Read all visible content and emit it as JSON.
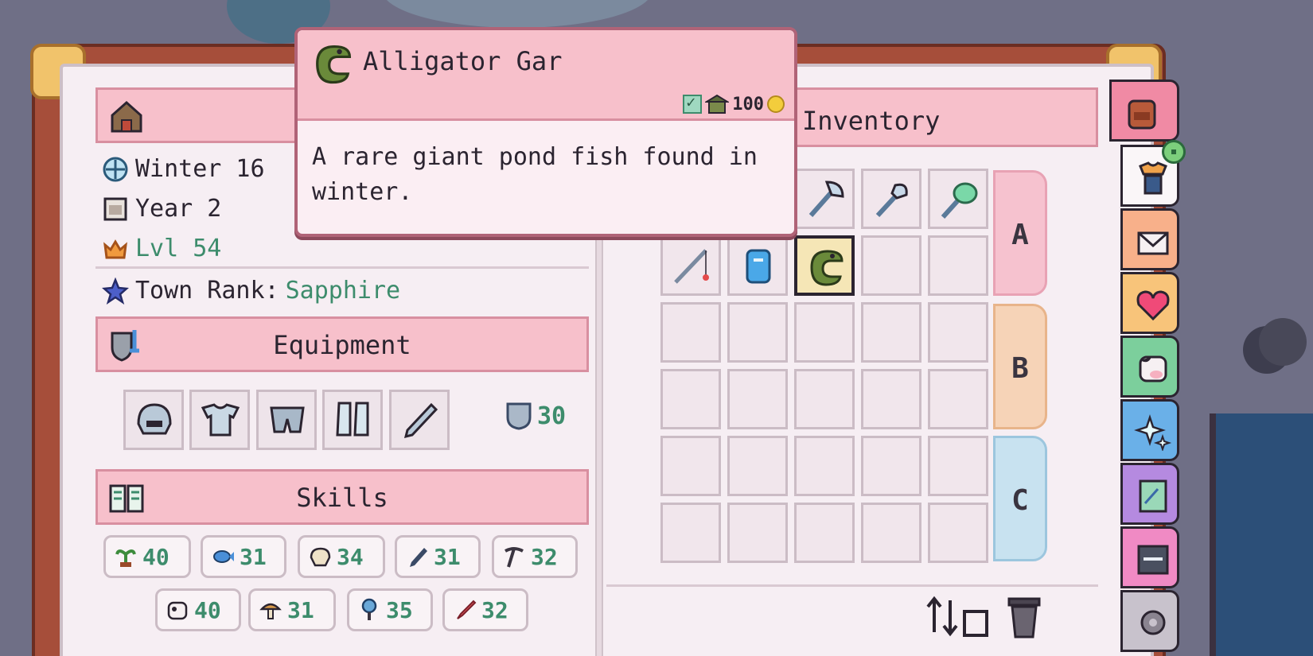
{
  "tooltip": {
    "item_name": "Alligator Gar",
    "description": "A rare giant pond fish found in winter.",
    "price": "100",
    "icon": "alligator-gar-icon"
  },
  "status": {
    "season": "Winter 16",
    "year": "Year 2",
    "level": "Lvl 54",
    "town_rank_label": "Town Rank:",
    "town_rank_value": "Sapphire"
  },
  "sections": {
    "equipment": "Equipment",
    "skills": "Skills",
    "inventory": "Inventory"
  },
  "equipment": {
    "slots": [
      "helmet-icon",
      "chestplate-icon",
      "leggings-icon",
      "boots-icon",
      "weapon-icon"
    ],
    "defense": "30"
  },
  "skills": [
    {
      "icon": "farming-skill-icon",
      "value": "40"
    },
    {
      "icon": "fishing-skill-icon",
      "value": "31"
    },
    {
      "icon": "archaeology-skill-icon",
      "value": "34"
    },
    {
      "icon": "cooking-skill-icon",
      "value": "31"
    },
    {
      "icon": "mining-skill-icon",
      "value": "32"
    },
    {
      "icon": "husbandry-skill-icon",
      "value": "40"
    },
    {
      "icon": "foraging-skill-icon",
      "value": "31"
    },
    {
      "icon": "bug-catching-skill-icon",
      "value": "35"
    },
    {
      "icon": "combat-skill-icon",
      "value": "32"
    }
  ],
  "inventory": {
    "row_labels": [
      "A",
      "B",
      "C"
    ],
    "items": [
      "axe-icon",
      "shovel-icon",
      "bug-net-icon",
      "fishing-rod-icon",
      "watering-can-icon",
      "alligator-gar-icon"
    ]
  },
  "side_tabs": [
    "backpack-icon",
    "clothing-icon",
    "mail-icon",
    "heart-icon",
    "cow-icon",
    "sparkle-icon",
    "map-icon",
    "calendar-icon",
    "settings-icon"
  ],
  "colors": {
    "accent_pink": "#f7c0cb",
    "green_text": "#3d8c6c",
    "row_a": "#f6c2cf",
    "row_b": "#f6d3b7",
    "row_c": "#c8e2f0"
  }
}
